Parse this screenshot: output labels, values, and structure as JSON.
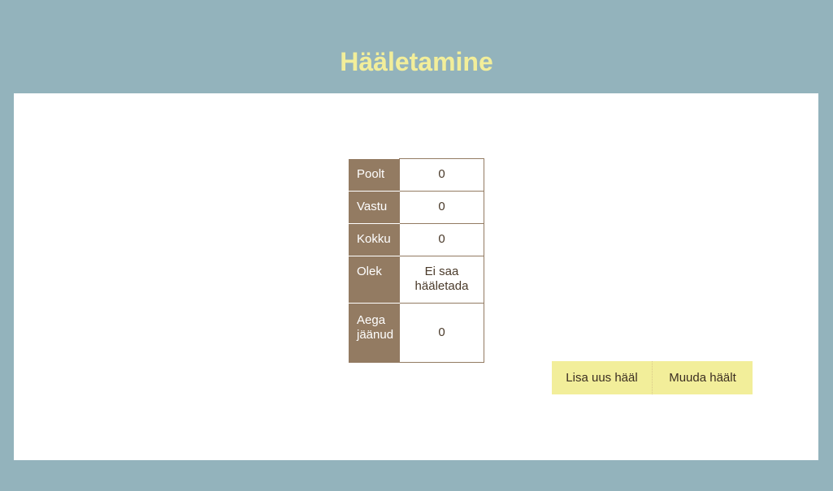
{
  "header": {
    "title": "Hääletamine"
  },
  "vote_table": {
    "rows": [
      {
        "label": "Poolt",
        "value": "0"
      },
      {
        "label": "Vastu",
        "value": "0"
      },
      {
        "label": "Kokku",
        "value": "0"
      },
      {
        "label": "Olek",
        "value": "Ei saa hääletada"
      },
      {
        "label": "Aega jäänud",
        "value": "0"
      }
    ]
  },
  "actions": {
    "add_vote_label": "Lisa uus hääl",
    "change_vote_label": "Muuda häält"
  },
  "colors": {
    "background": "#93b3bc",
    "title": "#f2ee9a",
    "table_header": "#937b62",
    "button": "#f2ee9a"
  }
}
